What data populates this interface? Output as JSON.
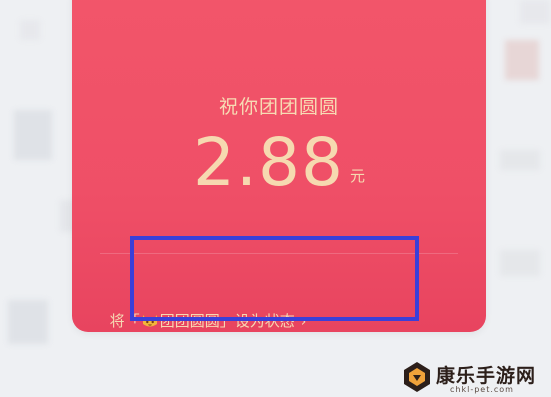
{
  "red_packet": {
    "greeting": "祝你团团圆圆",
    "amount": "2.88",
    "currency_unit": "元",
    "status_link": {
      "prefix": "将「",
      "status_name": "团团圆圆",
      "suffix": "」设为状态",
      "chevron": "›",
      "icon": "cat-emoji-icon"
    }
  },
  "watermark": {
    "name": "康乐手游网",
    "url": "chkl-pet.com"
  },
  "colors": {
    "card_red": "#ef4f67",
    "gold_text": "#f6d9b0",
    "highlight_blue": "#3b3fd8"
  }
}
